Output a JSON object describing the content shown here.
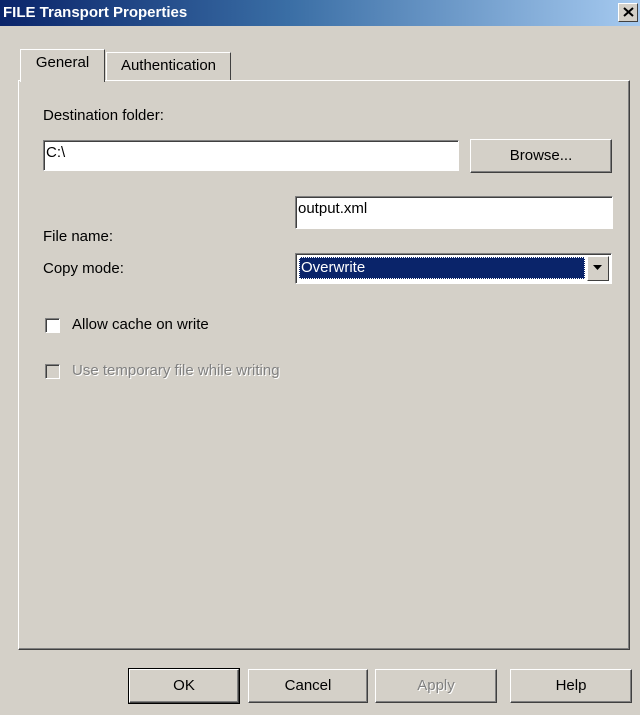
{
  "window": {
    "title": "FILE Transport Properties"
  },
  "tabs": [
    {
      "label": "General",
      "active": true
    },
    {
      "label": "Authentication",
      "active": false
    }
  ],
  "general": {
    "destination_folder_label": "Destination folder:",
    "destination_folder_value": "C:\\",
    "browse_label": "Browse...",
    "file_name_label": "File name:",
    "file_name_value": "output.xml",
    "copy_mode_label": "Copy mode:",
    "copy_mode_value": "Overwrite",
    "allow_cache_label": "Allow cache on write",
    "allow_cache_checked": false,
    "use_temp_label": "Use temporary file while writing",
    "use_temp_checked": false,
    "use_temp_enabled": false
  },
  "footer": {
    "ok_label": "OK",
    "cancel_label": "Cancel",
    "apply_label": "Apply",
    "help_label": "Help"
  },
  "colors": {
    "titlebar": "#0a246a",
    "dialog_bg": "#d4d0c8",
    "selection": "#0a246a"
  }
}
